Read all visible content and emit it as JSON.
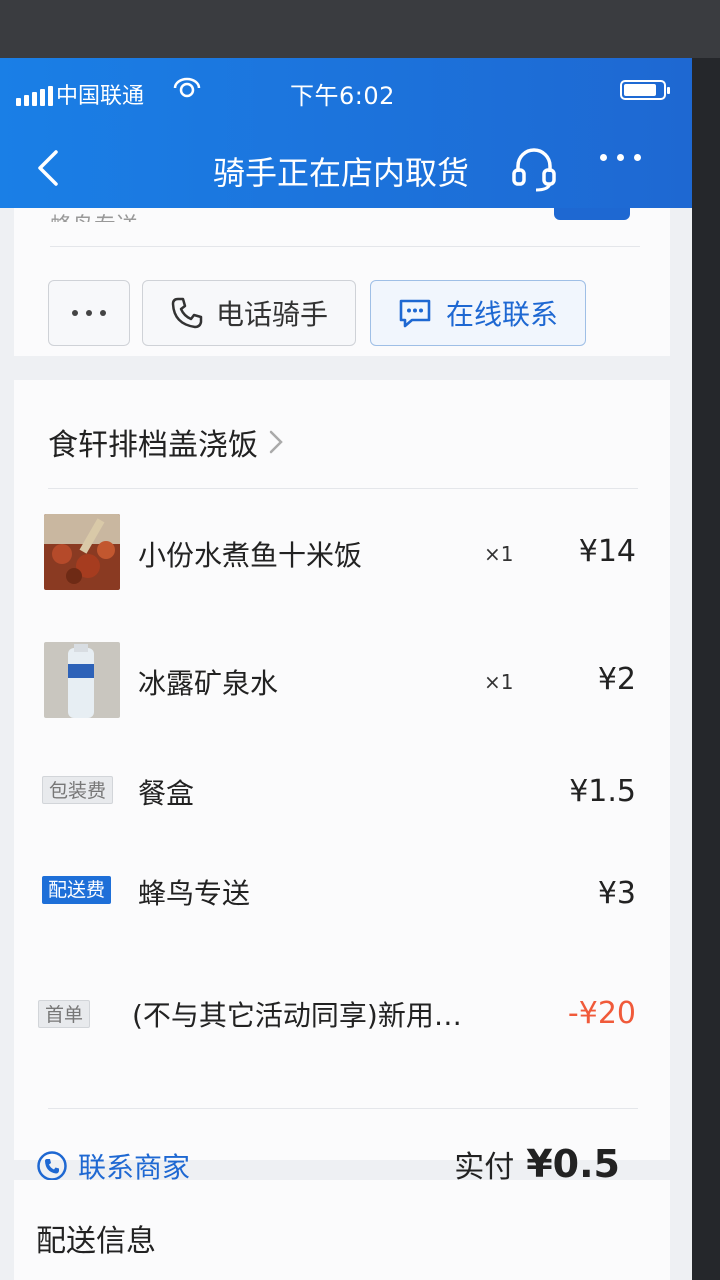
{
  "status_bar": {
    "carrier": "中国联通",
    "time": "下午6:02"
  },
  "nav": {
    "title": "骑手正在店内取货",
    "back_icon": "chevron-left-icon",
    "service_icon": "headset-icon",
    "more_icon": "more-dots-icon"
  },
  "rider_card": {
    "peek_text": "蜂鸟专送",
    "more_icon": "more-dots-icon",
    "call_label": "电话骑手",
    "call_icon": "phone-icon",
    "chat_label": "在线联系",
    "chat_icon": "chat-bubble-icon"
  },
  "order": {
    "shop_name": "食轩排档盖浇饭",
    "items": [
      {
        "name": "小份水煮鱼十米饭",
        "qty": "×1",
        "price": "¥14"
      },
      {
        "name": "冰露矿泉水",
        "qty": "×1",
        "price": "¥2"
      }
    ],
    "fees": [
      {
        "badge": "包装费",
        "name": "餐盒",
        "price": "¥1.5"
      },
      {
        "badge": "配送费",
        "name": "蜂鸟专送",
        "price": "¥3"
      },
      {
        "badge": "首单",
        "name": "(不与其它活动同享)新用…",
        "price": "-¥20"
      }
    ],
    "contact_label": "联系商家",
    "total_label": "实付",
    "total_amount": "¥0.5"
  },
  "delivery_section": {
    "title": "配送信息"
  },
  "colors": {
    "brand_blue": "#1e68d2",
    "discount_red": "#f05a3a"
  }
}
